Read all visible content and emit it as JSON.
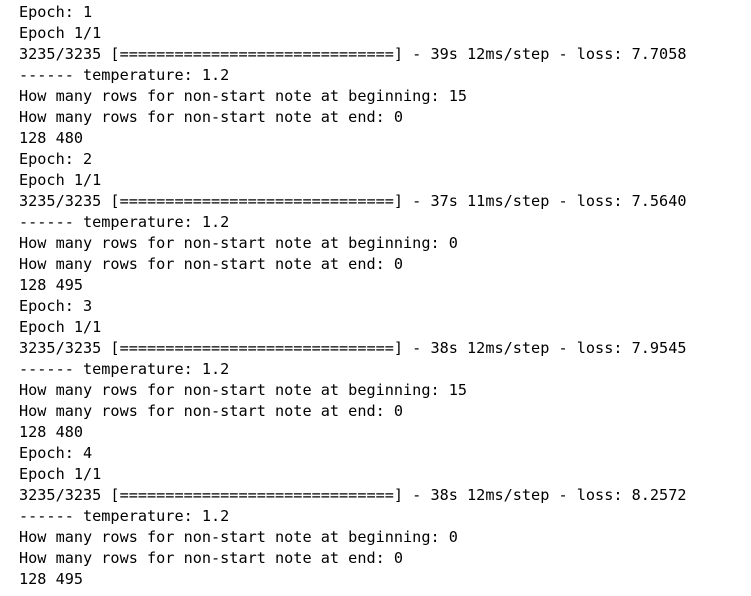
{
  "output": {
    "lines": [
      "Epoch: 1",
      "Epoch 1/1",
      "3235/3235 [==============================] - 39s 12ms/step - loss: 7.7058",
      "------ temperature: 1.2",
      "How many rows for non-start note at beginning: 15",
      "How many rows for non-start note at end: 0",
      "128 480",
      "Epoch: 2",
      "Epoch 1/1",
      "3235/3235 [==============================] - 37s 11ms/step - loss: 7.5640",
      "------ temperature: 1.2",
      "How many rows for non-start note at beginning: 0",
      "How many rows for non-start note at end: 0",
      "128 495",
      "Epoch: 3",
      "Epoch 1/1",
      "3235/3235 [==============================] - 38s 12ms/step - loss: 7.9545",
      "------ temperature: 1.2",
      "How many rows for non-start note at beginning: 15",
      "How many rows for non-start note at end: 0",
      "128 480",
      "Epoch: 4",
      "Epoch 1/1",
      "3235/3235 [==============================] - 38s 12ms/step - loss: 8.2572",
      "------ temperature: 1.2",
      "How many rows for non-start note at beginning: 0",
      "How many rows for non-start note at end: 0",
      "128 495"
    ]
  }
}
